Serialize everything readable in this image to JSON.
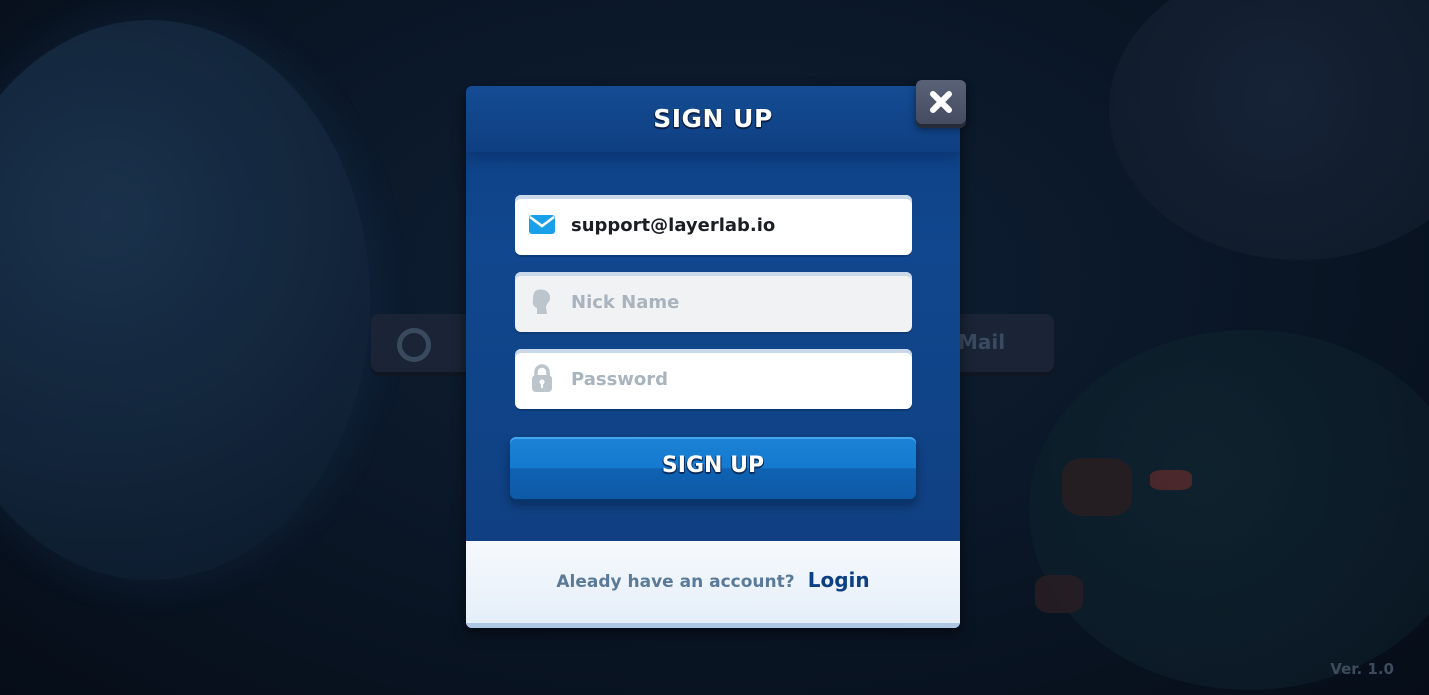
{
  "background": {
    "left_button_partial": "",
    "right_button_partial": "Mail",
    "version": "Ver. 1.0"
  },
  "dialog": {
    "title": "SIGN UP",
    "close_icon": "close-icon",
    "fields": {
      "email": {
        "value": "support@layerlab.io",
        "placeholder": "",
        "icon": "mail-icon"
      },
      "nickname": {
        "value": "",
        "placeholder": "Nick Name",
        "icon": "user-silhouette-icon"
      },
      "password": {
        "value": "",
        "placeholder": "Password",
        "icon": "lock-icon"
      }
    },
    "submit_label": "SIGN UP",
    "footer": {
      "prompt": "Aleady have an account?",
      "link": "Login"
    }
  },
  "colors": {
    "dialog_blue": "#0f3f82",
    "button_blue": "#157ad0",
    "mail_icon": "#1aa0e8",
    "placeholder_gray": "#a9b4be"
  }
}
